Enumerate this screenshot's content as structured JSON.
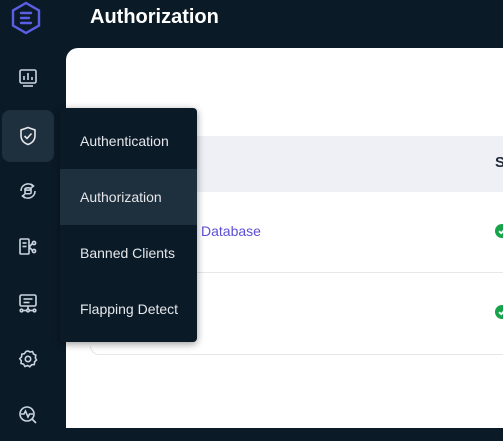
{
  "page": {
    "title": "Authorization"
  },
  "colors": {
    "sidebar_bg": "#0b1a27",
    "active_bg": "#1e2f3d",
    "link": "#5b4fd6",
    "status_ok": "#16a34a"
  },
  "sidebar": {
    "items": [
      {
        "icon": "dashboard-icon"
      },
      {
        "icon": "shield-check-icon"
      },
      {
        "icon": "data-integration-icon"
      },
      {
        "icon": "flow-icon"
      },
      {
        "icon": "diagnose-icon"
      },
      {
        "icon": "settings-icon"
      },
      {
        "icon": "monitor-icon"
      }
    ]
  },
  "submenu": {
    "items": [
      {
        "label": "Authentication"
      },
      {
        "label": "Authorization"
      },
      {
        "label": "Banned Clients"
      },
      {
        "label": "Flapping Detect"
      }
    ],
    "selected": "Authorization"
  },
  "table": {
    "status_header": "S",
    "rows": [
      {
        "name": "Database",
        "status_icon": "check-circle-icon"
      },
      {
        "name": "",
        "status_icon": "check-circle-icon"
      }
    ]
  }
}
